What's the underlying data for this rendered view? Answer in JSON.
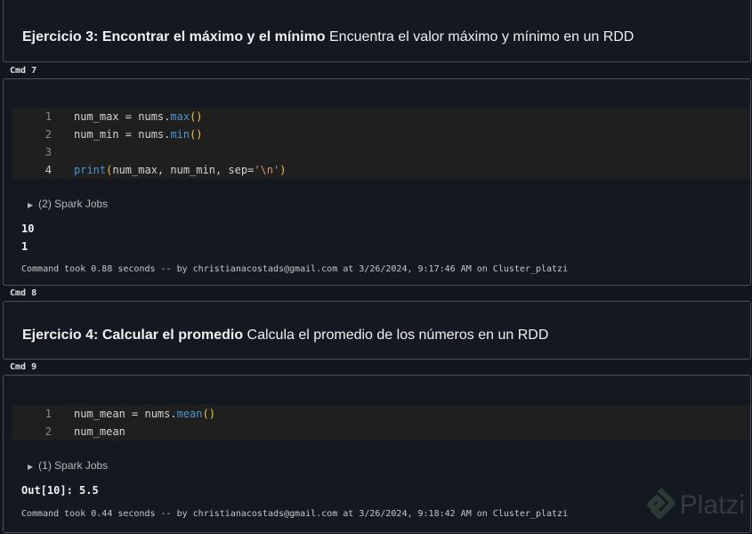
{
  "cells": [
    {
      "type": "markdown",
      "title_bold": "Ejercicio 3: Encontrar el máximo y el mínimo",
      "title_rest": " Encuentra el valor máximo y mínimo en un RDD"
    },
    {
      "label": "Cmd 7",
      "lines": [
        {
          "n": "1",
          "a": "num_max = nums.",
          "fn": "max",
          "p": "()"
        },
        {
          "n": "2",
          "a": "num_min = nums.",
          "fn": "min",
          "p": "()"
        },
        {
          "n": "3"
        },
        {
          "n": "4",
          "fn": "print",
          "p1": "(",
          "mid": "num_max, num_min, sep=",
          "str": "'\\n'",
          "p2": ")"
        }
      ],
      "jobs": "(2) Spark Jobs",
      "output": [
        "10",
        "1"
      ],
      "footer": "Command took 0.88 seconds -- by christianacostads@gmail.com at 3/26/2024, 9:17:46 AM on Cluster_platzi"
    },
    {
      "label": "Cmd 8",
      "type": "markdown",
      "title_bold": "Ejercicio 4: Calcular el promedio",
      "title_rest": " Calcula el promedio de los números en un RDD"
    },
    {
      "label": "Cmd 9",
      "lines": [
        {
          "n": "1",
          "a": "num_mean = nums.",
          "fn": "mean",
          "p": "()"
        },
        {
          "n": "2",
          "a": "num_mean"
        }
      ],
      "jobs": "(1) Spark Jobs",
      "output": [
        "Out[10]: 5.5"
      ],
      "footer": "Command took 0.44 seconds -- by christianacostads@gmail.com at 3/26/2024, 9:18:42 AM on Cluster_platzi"
    }
  ],
  "watermark": "Platzi"
}
